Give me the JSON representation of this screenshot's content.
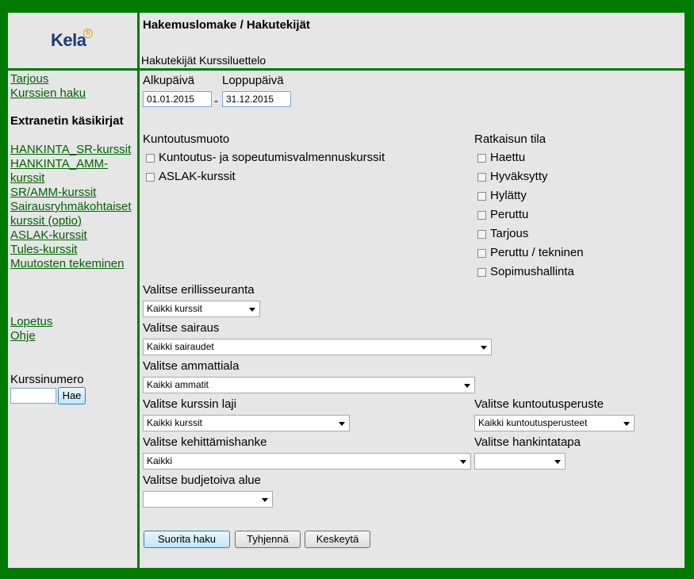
{
  "logo": {
    "text": "Kela"
  },
  "header": {
    "title": "Hakemuslomake / Hakutekijät",
    "nav": "Hakutekijät Kurssiluettelo"
  },
  "sidebar": {
    "links_top": [
      "Tarjous",
      "Kurssien haku"
    ],
    "heading": "Extranetin käsikirjat",
    "manual_links": [
      "HANKINTA_SR-kurssit",
      "HANKINTA_AMM-kurssit",
      "SR/AMM-kurssit",
      "Sairausryhmäkohtaiset kurssit (optio)",
      "ASLAK-kurssit",
      "Tules-kurssit",
      "Muutosten tekeminen"
    ],
    "links_bottom": [
      "Lopetus",
      "Ohje"
    ],
    "course_number_label": "Kurssinumero",
    "course_number_value": "",
    "search_button": "Hae"
  },
  "form": {
    "start_date_label": "Alkupäivä",
    "start_date": "01.01.2015",
    "end_date_label": "Loppupäivä",
    "end_date": "31.12.2015",
    "date_sep": "-",
    "rehab_type_label": "Kuntoutusmuoto",
    "rehab_types": [
      "Kuntoutus- ja sopeutumisvalmennuskurssit",
      "ASLAK-kurssit"
    ],
    "decision_status_label": "Ratkaisun tila",
    "decision_statuses": [
      "Haettu",
      "Hyväksytty",
      "Hylätty",
      "Peruttu",
      "Tarjous",
      "Peruttu / tekninen",
      "Sopimushallinta"
    ],
    "tracking_label": "Valitse erillisseuranta",
    "tracking_value": "Kaikki kurssit",
    "disease_label": "Valitse sairaus",
    "disease_value": "Kaikki sairaudet",
    "profession_label": "Valitse ammattiala",
    "profession_value": "Kaikki ammatit",
    "course_type_label": "Valitse kurssin laji",
    "course_type_value": "Kaikki kurssit",
    "rehab_basis_label": "Valitse kuntoutusperuste",
    "rehab_basis_value": "Kaikki kuntoutusperusteet",
    "dev_project_label": "Valitse kehittämishanke",
    "dev_project_value": "Kaikki",
    "procurement_label": "Valitse hankintatapa",
    "procurement_value": "",
    "budget_label": "Valitse budjetoiva alue",
    "budget_value": ""
  },
  "buttons": {
    "search": "Suorita haku",
    "clear": "Tyhjennä",
    "cancel": "Keskeytä"
  }
}
